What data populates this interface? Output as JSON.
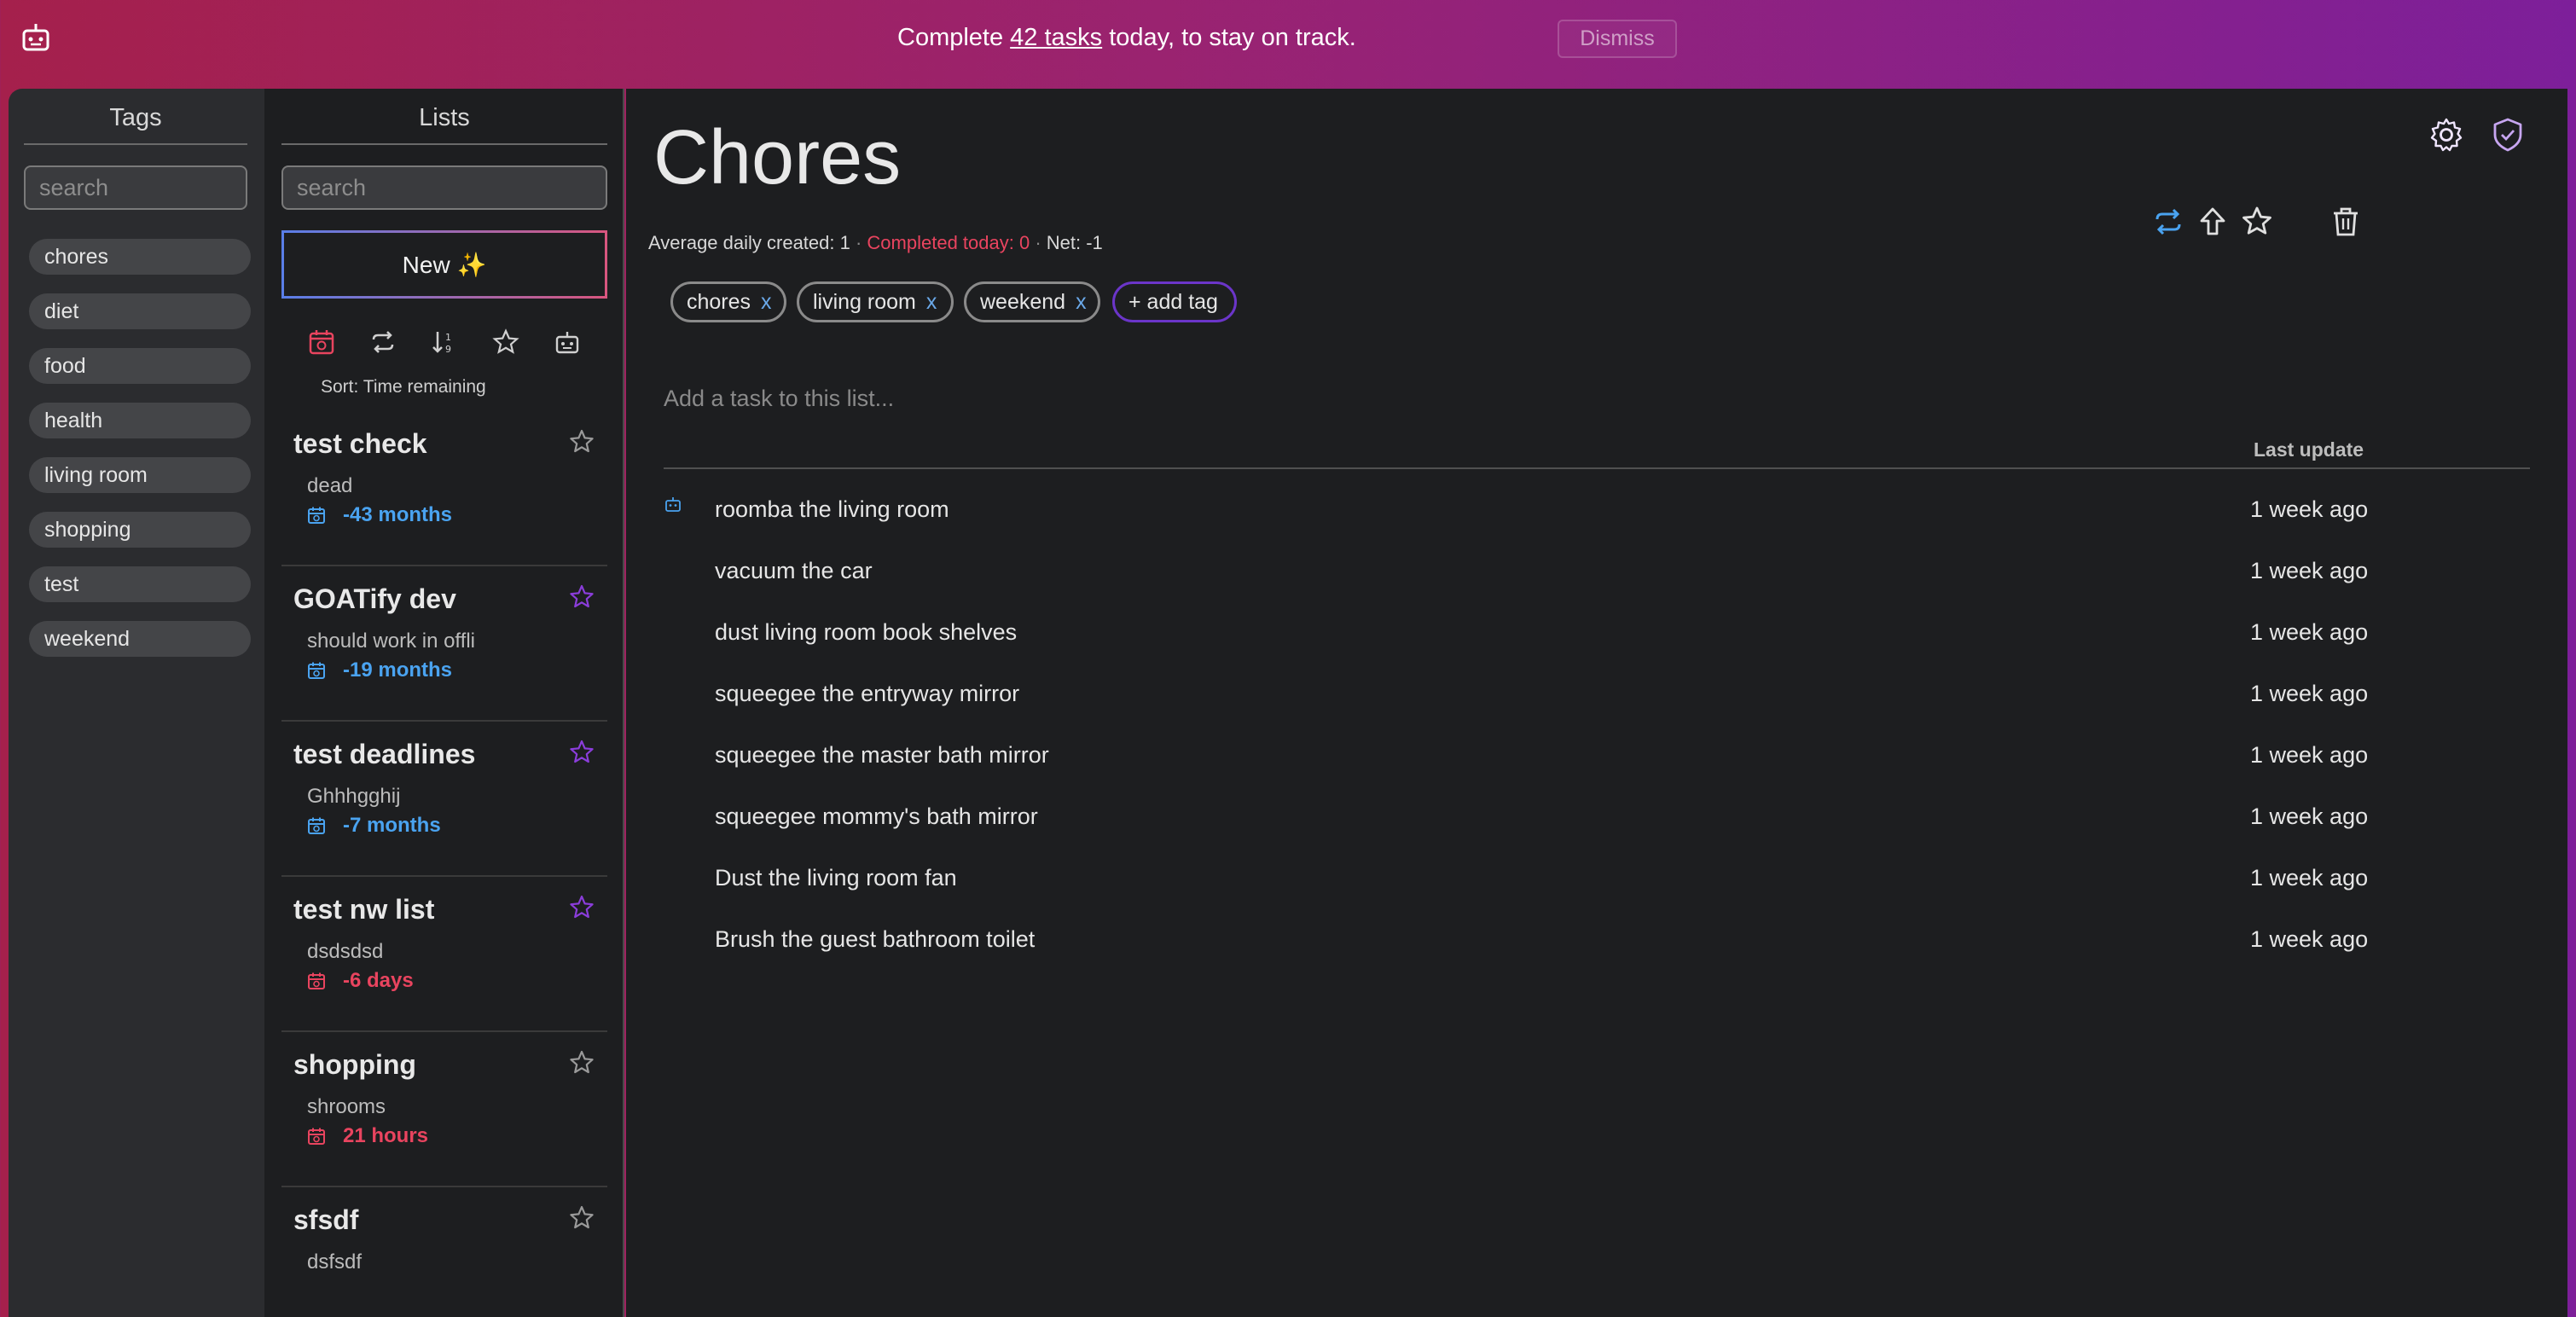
{
  "banner": {
    "prefix": "Complete ",
    "link": "42 tasks",
    "suffix": " today, to stay on track.",
    "dismiss_label": "Dismiss"
  },
  "tags": {
    "title": "Tags",
    "search_placeholder": "search",
    "items": [
      "chores",
      "diet",
      "food",
      "health",
      "living room",
      "shopping",
      "test",
      "weekend"
    ]
  },
  "lists": {
    "title": "Lists",
    "search_placeholder": "search",
    "new_label": "New ✨",
    "sort_label": "Sort:  Time remaining",
    "items": [
      {
        "title": "test check",
        "subtitle": "dead",
        "due": "-43 months",
        "due_color": "#4aa3f0",
        "starred": false
      },
      {
        "title": "GOATify dev",
        "subtitle": "should work in offli",
        "due": "-19 months",
        "due_color": "#4aa3f0",
        "starred": true
      },
      {
        "title": "test deadlines",
        "subtitle": "Ghhhgghij",
        "due": "-7 months",
        "due_color": "#4aa3f0",
        "starred": true
      },
      {
        "title": "test nw list",
        "subtitle": "dsdsdsd",
        "due": "-6 days",
        "due_color": "#e9445f",
        "starred": true
      },
      {
        "title": "shopping",
        "subtitle": "shrooms",
        "due": "21 hours",
        "due_color": "#e9445f",
        "starred": false
      },
      {
        "title": "sfsdf",
        "subtitle": "dsfsdf",
        "due": "",
        "due_color": "#e9445f",
        "starred": false
      }
    ]
  },
  "main": {
    "title": "Chores",
    "stats": {
      "created": "Average daily created: 1",
      "sep": " · ",
      "completed": "Completed today: 0",
      "net": "Net: -1"
    },
    "chips": [
      "chores",
      "living room",
      "weekend"
    ],
    "chip_remove": "x",
    "add_tag_label": "+ add tag",
    "add_task_placeholder": "Add a task to this list...",
    "column_header": "Last update",
    "tasks": [
      {
        "text": "roomba the living room",
        "time": "1 week ago",
        "robot": true
      },
      {
        "text": "vacuum the car",
        "time": "1 week ago",
        "robot": false
      },
      {
        "text": "dust living room book shelves",
        "time": "1 week ago",
        "robot": false
      },
      {
        "text": "squeegee the entryway mirror",
        "time": "1 week ago",
        "robot": false
      },
      {
        "text": "squeegee the master bath mirror",
        "time": "1 week ago",
        "robot": false
      },
      {
        "text": "squeegee mommy's bath mirror",
        "time": "1 week ago",
        "robot": false
      },
      {
        "text": "Dust the living room fan",
        "time": "1 week ago",
        "robot": false
      },
      {
        "text": "Brush the guest bathroom toilet",
        "time": "1 week ago",
        "robot": false
      }
    ]
  },
  "colors": {
    "accent_blue": "#4aa3f0",
    "accent_red": "#e9445f",
    "accent_purple": "#8b3ddb",
    "panel": "#1d1e20",
    "sidebar": "#2b2c2f"
  }
}
